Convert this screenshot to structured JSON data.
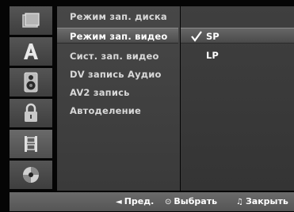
{
  "icons": [
    {
      "name": "disc-tray-icon"
    },
    {
      "name": "letter-a-icon"
    },
    {
      "name": "speaker-icon"
    },
    {
      "name": "padlock-icon"
    },
    {
      "name": "film-strip-icon"
    },
    {
      "name": "disc-icon"
    }
  ],
  "menu": {
    "items": [
      {
        "label": "Режим зап. диска"
      },
      {
        "label": "Режим зап. видео"
      },
      {
        "label": "Сист. зап. видео"
      },
      {
        "label": "DV запись Аудио"
      },
      {
        "label": "AV2 запись"
      },
      {
        "label": "Автоделение"
      }
    ],
    "selected_index": 1
  },
  "options": {
    "items": [
      {
        "label": "SP"
      },
      {
        "label": "LP"
      }
    ],
    "selected_index": 0
  },
  "footer": {
    "prev_symbol": "◄",
    "prev_label": "Пред.",
    "select_symbol": "⊙",
    "select_label": "Выбрать",
    "close_symbol": "♫",
    "close_label": "Закрыть"
  },
  "colors": {
    "panel": "#444444",
    "highlight": "#5c5c5c",
    "text": "#ffffff",
    "background": "#000000"
  }
}
